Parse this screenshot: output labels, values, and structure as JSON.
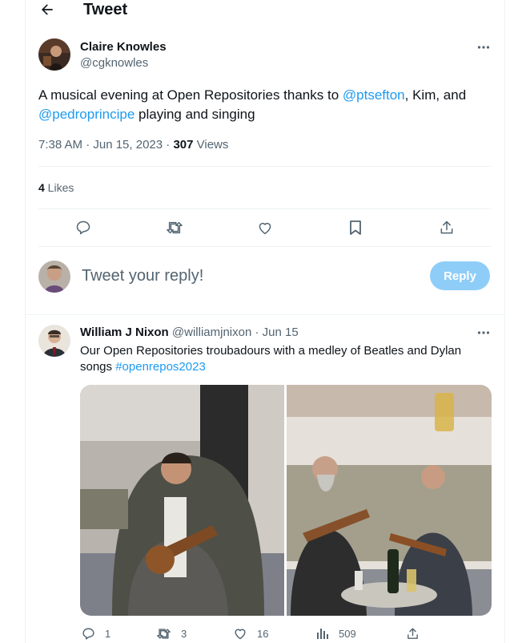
{
  "header": {
    "back_icon": "arrow-left-icon",
    "title": "Tweet"
  },
  "tweet": {
    "author_name": "Claire Knowles",
    "author_handle": "@cgknowles",
    "more_icon": "more-horizontal-icon",
    "text_before_mention1": "A musical evening at Open Repositories thanks to ",
    "mention1": "@ptsefton",
    "text_between": ", Kim, and",
    "mention2": "@pedroprincipe",
    "text_after": " playing and singing",
    "timestamp": "7:38 AM · Jun 15, 2023 · ",
    "views_count": "307",
    "views_label": " Views",
    "likes_count": "4",
    "likes_label": " Likes",
    "actions": [
      "reply-icon",
      "retweet-icon",
      "like-icon",
      "bookmark-icon",
      "share-icon"
    ]
  },
  "reply_composer": {
    "placeholder": "Tweet your reply!",
    "button_label": "Reply",
    "button_color": "#8ecdf8"
  },
  "reply": {
    "author_name": "William J Nixon",
    "author_handle": "@williamjnixon",
    "separator": " · ",
    "date": "Jun 15",
    "text_line1": "Our Open Repositories troubadours with a medley of Beatles and Dylan",
    "text_line2_plain": "songs ",
    "hashtag": "#openrepos2023",
    "metrics": {
      "replies": "1",
      "retweets": "3",
      "likes": "16",
      "views": "509"
    }
  },
  "colors": {
    "link": "#1d9bf0",
    "text": "#0f1419",
    "muted": "#536471",
    "border": "#eff3f4"
  }
}
